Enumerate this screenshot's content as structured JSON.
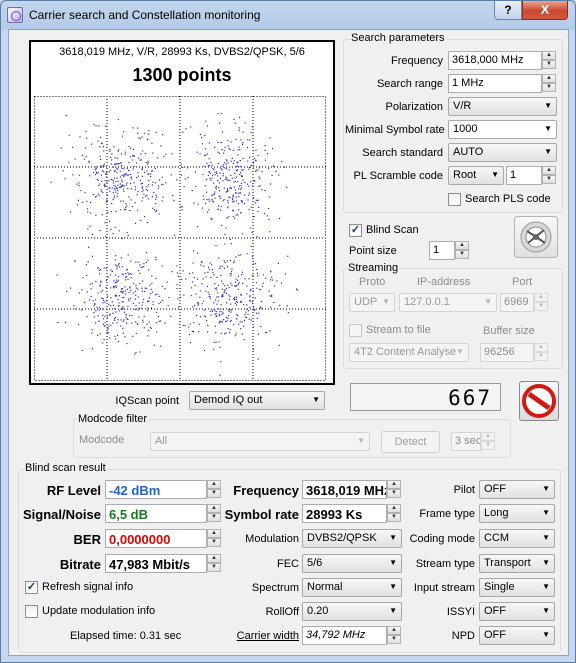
{
  "window": {
    "title": "Carrier search and Constellation monitoring",
    "help": "?",
    "close": "X"
  },
  "constellation": {
    "header": "3618,019 MHz, V/R, 28993 Ks, DVBS2/QPSK, 5/6",
    "points_label": "1300 points",
    "point_count": 1300,
    "point_color": "#2a2fc2"
  },
  "search": {
    "group_title": "Search parameters",
    "frequency_label": "Frequency",
    "frequency_value": "3618,000 MHz",
    "range_label": "Search range",
    "range_value": "1 MHz",
    "polarization_label": "Polarization",
    "polarization_value": "V/R",
    "min_sr_label": "Minimal Symbol rate",
    "min_sr_value": "1000",
    "standard_label": "Search standard",
    "standard_value": "AUTO",
    "pl_label": "PL Scramble code",
    "pl_mode": "Root",
    "pl_value": "1",
    "pls_check_label": "Search PLS code",
    "pls_checked": false
  },
  "blind_scan": {
    "label": "Blind Scan",
    "checked": true,
    "point_size_label": "Point size",
    "point_size_value": "1"
  },
  "streaming": {
    "title": "Streaming",
    "proto_label": "Proto",
    "ip_label": "IP-address",
    "port_label": "Port",
    "proto_value": "UDP",
    "ip_value": "127.0.0.1",
    "port_value": "6969",
    "stream_file_label": "Stream to file",
    "stream_file_checked": false,
    "buffer_label": "Buffer size",
    "file_value": "4T2 Content Analyse",
    "buffer_value": "96256"
  },
  "iqscan": {
    "label": "IQScan point",
    "value": "Demod IQ out"
  },
  "counter": {
    "value": "667"
  },
  "stop_button": {
    "icon": "stop-icon",
    "color": "#d01a12"
  },
  "modcode_filter": {
    "title": "Modcode filter",
    "label": "Modcode",
    "value": "All",
    "detect": "Detect",
    "time": "3 sec"
  },
  "result": {
    "title": "Blind scan result",
    "rf_level_label": "RF Level",
    "rf_level_value": "-42 dBm",
    "rf_level_color": "#1f63c6",
    "snr_label": "Signal/Noise",
    "snr_value": "6,5 dB",
    "snr_color": "#1b7a1b",
    "ber_label": "BER",
    "ber_value": "0,0000000",
    "ber_color": "#e00000",
    "bitrate_label": "Bitrate",
    "bitrate_value": "47,983 Mbit/s",
    "frequency_label": "Frequency",
    "frequency_value": "3618,019 MHz",
    "symbol_rate_label": "Symbol rate",
    "symbol_rate_value": "28993 Ks",
    "modulation_label": "Modulation",
    "modulation_value": "DVBS2/QPSK",
    "fec_label": "FEC",
    "fec_value": "5/6",
    "spectrum_label": "Spectrum",
    "spectrum_value": "Normal",
    "rolloff_label": "RollOff",
    "rolloff_value": "0.20",
    "carrier_width_label": "Carrier width",
    "carrier_width_value": "34,792 MHz",
    "pilot_label": "Pilot",
    "pilot_value": "OFF",
    "frame_label": "Frame type",
    "frame_value": "Long",
    "coding_label": "Coding mode",
    "coding_value": "CCM",
    "stream_type_label": "Stream type",
    "stream_type_value": "Transport",
    "input_stream_label": "Input stream",
    "input_stream_value": "Single",
    "issyi_label": "ISSYI",
    "issyi_value": "OFF",
    "npd_label": "NPD",
    "npd_value": "OFF",
    "refresh_label": "Refresh signal info",
    "refresh_checked": true,
    "update_label": "Update modulation info",
    "update_checked": false,
    "elapsed_label": "Elapsed time: 0.31 sec"
  }
}
